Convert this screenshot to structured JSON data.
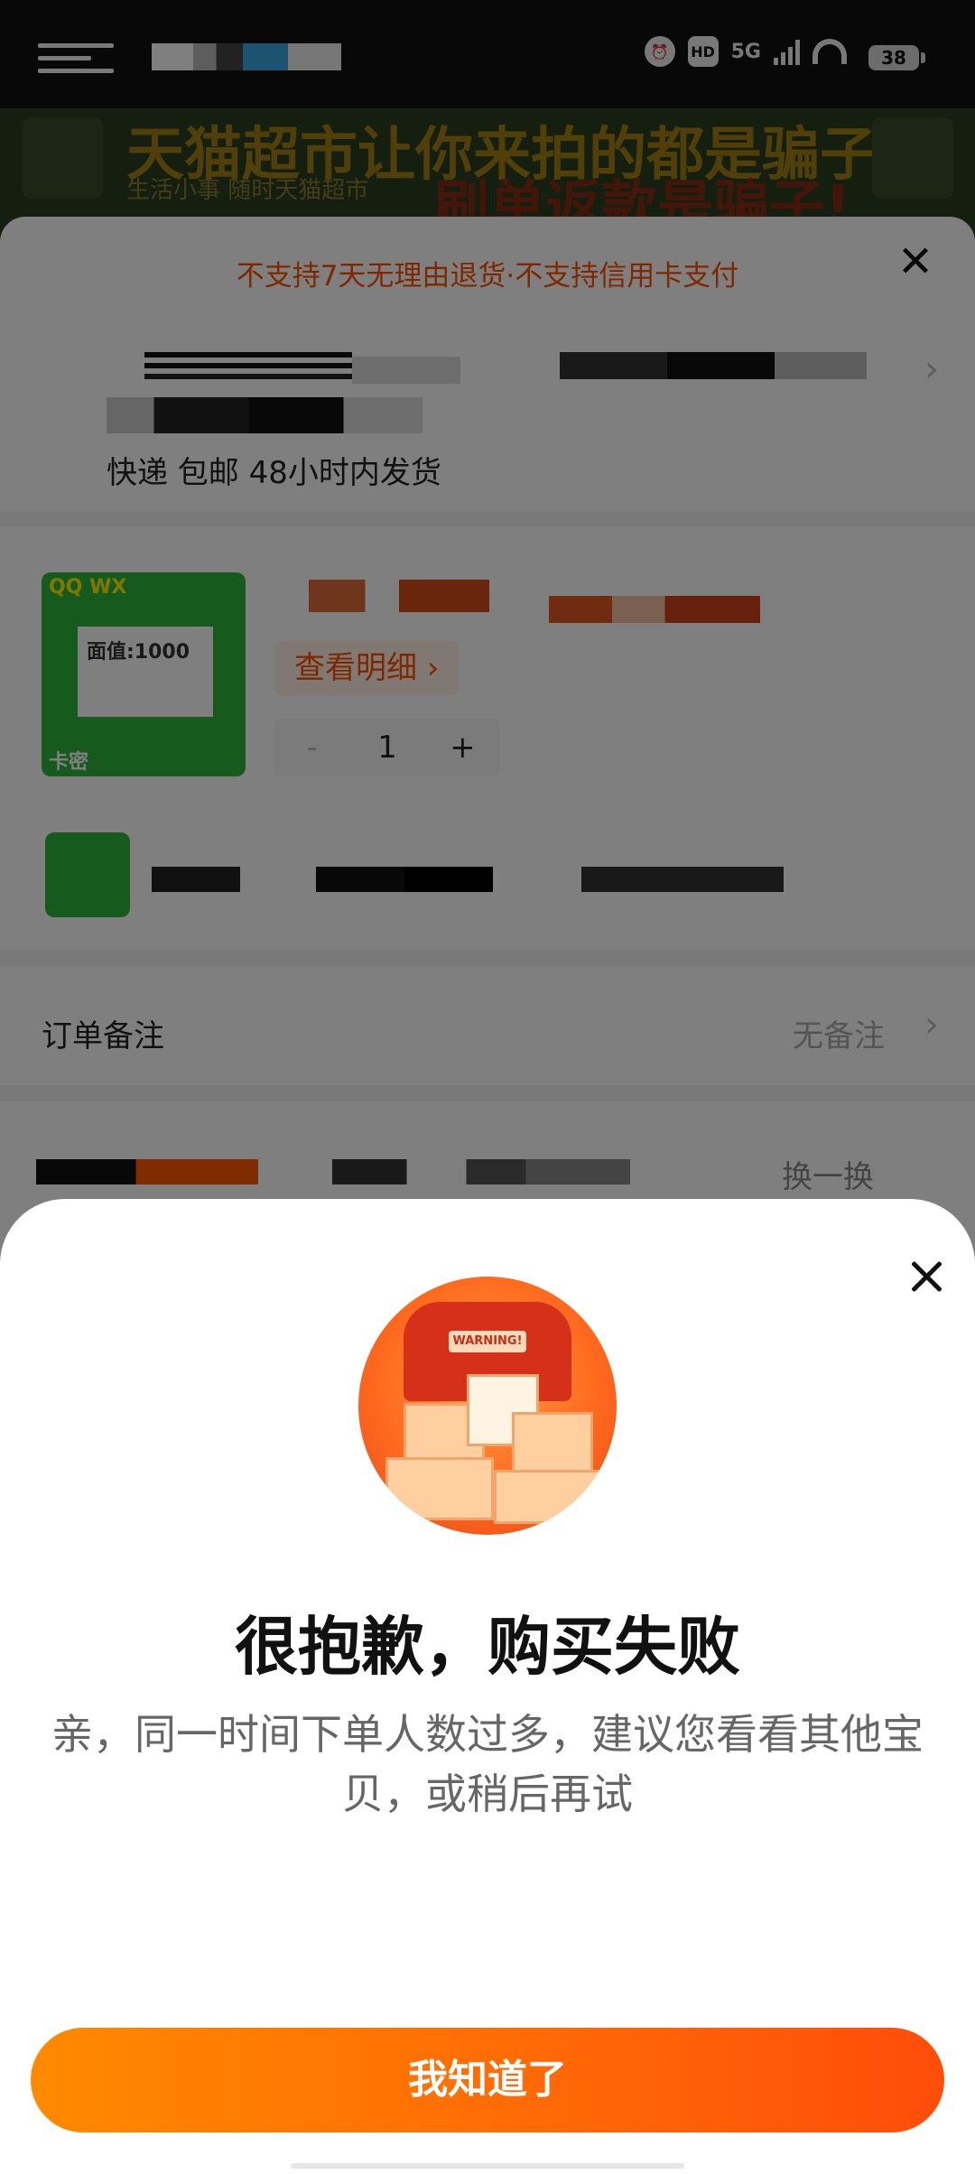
{
  "status_bar": {
    "hd_badge": "HD",
    "network": "5G",
    "battery_level": "38"
  },
  "banner": {
    "headline": "天猫超市让你来拍的都是骗子!",
    "subheadline": "刷单返款是骗子!",
    "tagline": "生活小事 随时天猫超市"
  },
  "order": {
    "notice": "不支持7天无理由退货·不支持信用卡支付",
    "shipping": "快递 包邮 48小时内发货",
    "product": {
      "detail_button": "查看明细 ›",
      "quantity": "1",
      "minus": "-",
      "plus": "+"
    },
    "thumb_text": {
      "brand": "QQ WX",
      "face_value": "面值:1000",
      "card_secret": "卡密"
    },
    "remark": {
      "label": "订单备注",
      "value": "无备注"
    },
    "swap_label": "换一换"
  },
  "dialog": {
    "illustration_tag": "WARNING!",
    "title": "很抱歉，购买失败",
    "message": "亲，同一时间下单人数过多，建议您看看其他宝贝，或稍后再试",
    "confirm_button": "我知道了"
  },
  "colors": {
    "accent": "#ff5000",
    "button_start": "#ff8a00",
    "button_end": "#ff4d0a"
  },
  "icons": [
    "menu-icon",
    "alarm-icon",
    "signal-icon",
    "wifi-icon",
    "battery-icon",
    "close-icon",
    "chevron-right-icon"
  ]
}
